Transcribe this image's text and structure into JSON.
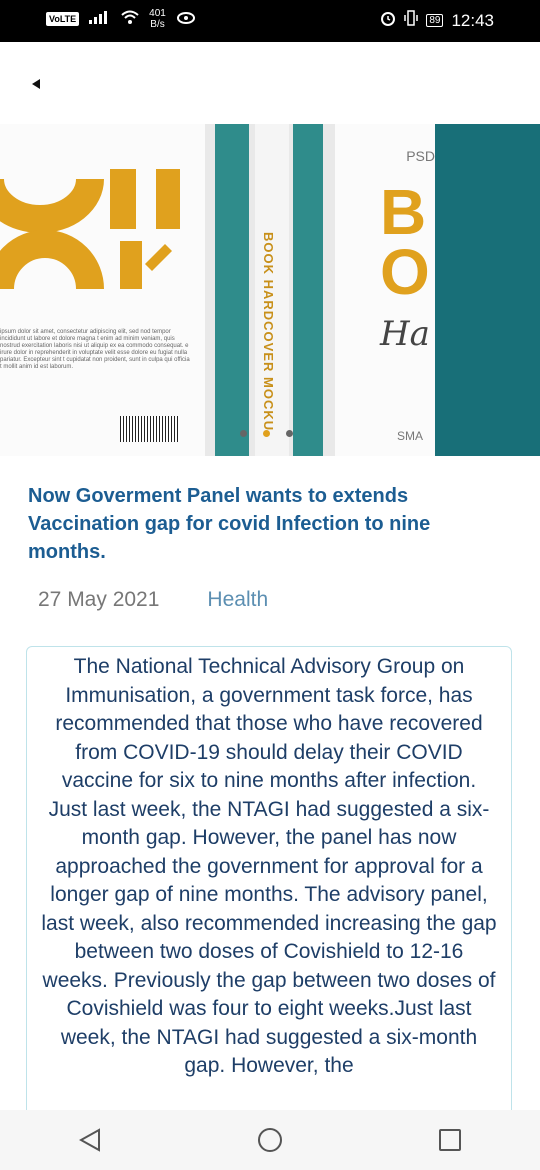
{
  "status": {
    "volte": "VoLTE",
    "net_speed": "401",
    "net_unit": "B/s",
    "battery": "89",
    "time": "12:43"
  },
  "icons": {
    "back": "back-arrow-icon",
    "signal": "signal-icon",
    "wifi": "wifi-icon",
    "eye": "eye-icon",
    "alarm": "alarm-icon",
    "vibrate": "vibrate-icon",
    "battery": "battery-icon"
  },
  "hero": {
    "spine_text": "BOOK HARDCOVER MOCKU",
    "psd_label": "PSD",
    "ha_text": "Ha",
    "smart_text": "SMA",
    "lorem": "ipsum dolor sit amet, consectetur adipiscing elit, sed nod tempor incididunt ut labore et dolore magna t enim ad minim veniam, quis nostrud exercitation laboris nisi ut aliquip ex ea commodo consequat. e irure dolor in reprehenderit in voluptate velit esse dolore eu fugiat nulla pariatur. Excepteur sint t cupidatat non proident, sunt in culpa qui officia t mollit anim id est laborum.",
    "slides": 3,
    "active_slide": 2
  },
  "article": {
    "title": "Now Goverment Panel wants to extends Vaccination gap for covid Infection to nine months.",
    "date": "27 May 2021",
    "category": "Health",
    "body": "The National Technical Advisory Group on Immunisation, a government task force, has  recommended that those who have recovered from COVID-19 should delay their COVID vaccine for six to nine months after infection. Just last week, the NTAGI had suggested a six-month gap. However, the panel has now approached the government for approval for a longer gap of nine months. The advisory panel, last week, also recommended increasing the gap between two doses of Covishield to 12-16 weeks. Previously the gap between two doses of Covishield was four to eight weeks.Just last week, the NTAGI had suggested a six-month gap. However, the"
  },
  "colors": {
    "title": "#1c5d92",
    "category": "#5c8fb2",
    "teal": "#2f8c8b",
    "accent_yellow": "#e0a11e"
  }
}
